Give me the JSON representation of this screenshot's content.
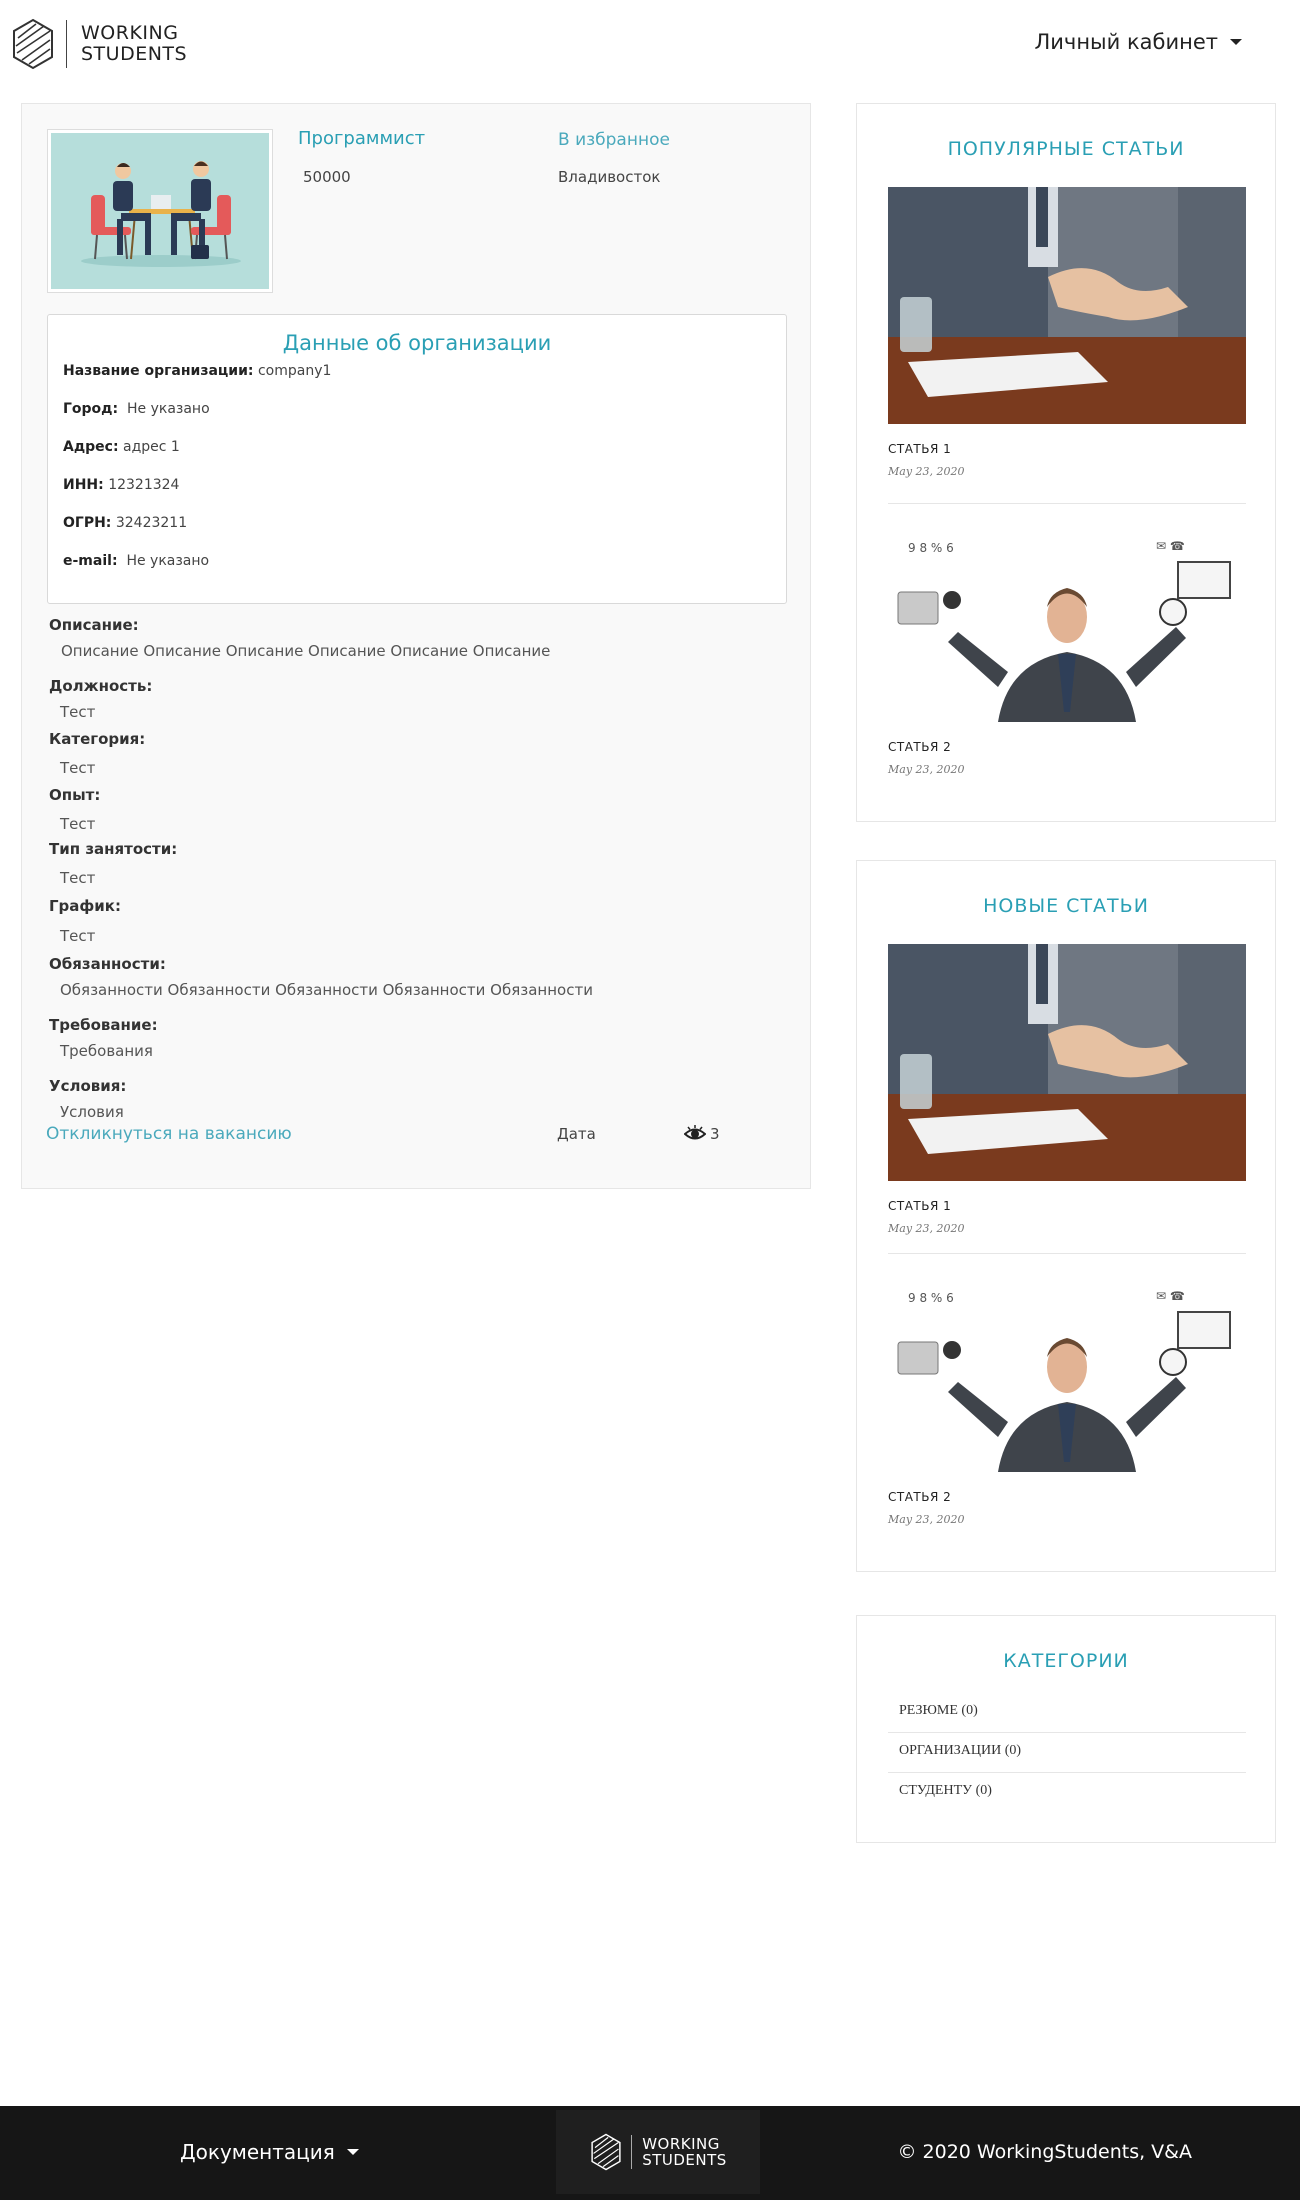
{
  "header": {
    "logo_line1": "WORKING",
    "logo_line2": "STUDENTS",
    "account_menu_label": "Личный кабинет"
  },
  "vacancy": {
    "title": "Программист",
    "salary": "50000",
    "favorite_label": "В избранное",
    "city": "Владивосток",
    "organization": {
      "heading": "Данные об организации",
      "rows": [
        {
          "label": "Название организации:",
          "value": "company1"
        },
        {
          "label": "Город:",
          "value": "Не указано"
        },
        {
          "label": "Адрес:",
          "value": "адрес 1"
        },
        {
          "label": "ИНН:",
          "value": "12321324"
        },
        {
          "label": "ОГРН:",
          "value": "32423211"
        },
        {
          "label": "e-mail:",
          "value": "Не указано"
        }
      ]
    },
    "fields": [
      {
        "label": "Описание:",
        "value": "Описание Описание Описание Описание Описание Описание"
      },
      {
        "label": "Должность:",
        "value": "Тест"
      },
      {
        "label": "Категория:",
        "value": "Тест"
      },
      {
        "label": "Опыт:",
        "value": "Тест"
      },
      {
        "label": "Тип занятости:",
        "value": "Тест"
      },
      {
        "label": "График:",
        "value": "Тест"
      },
      {
        "label": "Обязанности:",
        "value": "Обязанности Обязанности Обязанности Обязанности Обязанности"
      },
      {
        "label": "Требование:",
        "value": "Требования"
      },
      {
        "label": "Условия:",
        "value": "Условия"
      }
    ],
    "apply_label": "Откликнуться на вакансию",
    "date_label": "Дата",
    "views_count": "3"
  },
  "popular": {
    "title": "ПОПУЛЯРНЫЕ СТАТЬИ",
    "articles": [
      {
        "name": "СТАТЬЯ 1",
        "date": "May 23, 2020",
        "image": "handshake"
      },
      {
        "name": "СТАТЬЯ 2",
        "date": "May 23, 2020",
        "image": "multitasking-man"
      }
    ]
  },
  "newest": {
    "title": "НОВЫЕ СТАТЬИ",
    "articles": [
      {
        "name": "СТАТЬЯ 1",
        "date": "May 23, 2020",
        "image": "handshake"
      },
      {
        "name": "СТАТЬЯ 2",
        "date": "May 23, 2020",
        "image": "multitasking-man"
      }
    ]
  },
  "categories": {
    "title": "КАТЕГОРИИ",
    "items": [
      {
        "label": "РЕЗЮМЕ (0)"
      },
      {
        "label": "ОРГАНИЗАЦИИ (0)"
      },
      {
        "label": "СТУДЕНТУ (0)"
      }
    ]
  },
  "footer": {
    "docs_label": "Документация",
    "logo_line1": "WORKING",
    "logo_line2": "STUDENTS",
    "copyright": "© 2020 WorkingStudents, V&A"
  },
  "colors": {
    "accent": "#2a9fb4",
    "card_bg": "#f9f9f9",
    "footer_bg": "#161616"
  }
}
